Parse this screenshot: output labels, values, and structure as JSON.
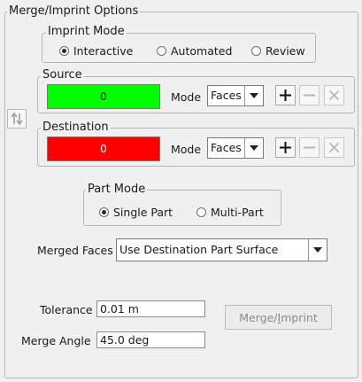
{
  "panel_title": "Merge/Imprint Options",
  "imprint_mode": {
    "title": "Imprint Mode",
    "options": [
      {
        "label": "Interactive",
        "selected": true
      },
      {
        "label": "Automated",
        "selected": false
      },
      {
        "label": "Review",
        "selected": false
      }
    ]
  },
  "source": {
    "title": "Source",
    "count": "0",
    "color": "#00ff00",
    "mode_label": "Mode",
    "mode_value": "Faces"
  },
  "destination": {
    "title": "Destination",
    "count": "0",
    "color": "#ff0000",
    "mode_label": "Mode",
    "mode_value": "Faces"
  },
  "part_mode": {
    "title": "Part Mode",
    "options": [
      {
        "label": "Single Part",
        "selected": true
      },
      {
        "label": "Multi-Part",
        "selected": false
      }
    ]
  },
  "merged_faces": {
    "label": "Merged Faces",
    "value": "Use Destination Part Surface"
  },
  "tolerance": {
    "label": "Tolerance",
    "value": "0.01 m"
  },
  "merge_angle": {
    "label": "Merge Angle",
    "value": "45.0 deg"
  },
  "merge_button": {
    "label_prefix": "Merge/",
    "label_underlined": "I",
    "label_suffix": "mprint"
  }
}
